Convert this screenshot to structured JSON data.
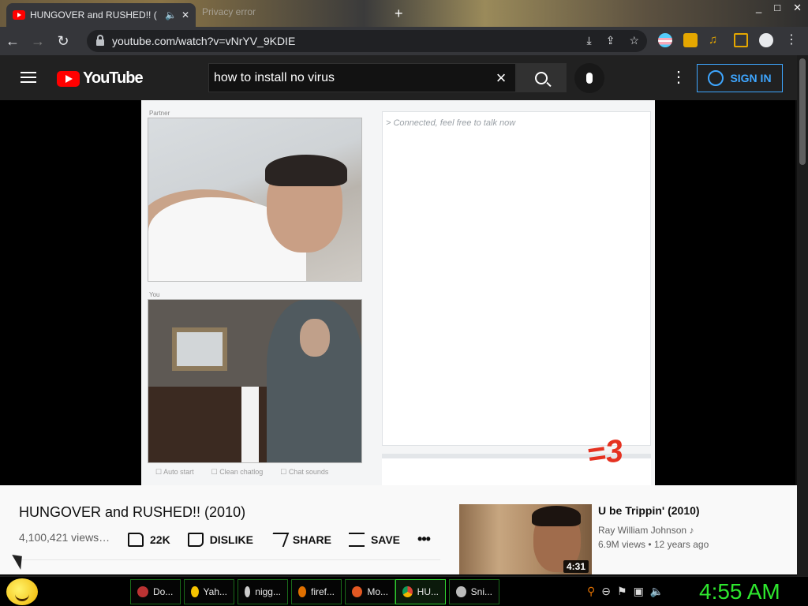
{
  "browser": {
    "tab_title": "HUNGOVER and RUSHED!! (",
    "tab2_title": "Privacy error",
    "new_tab": "+",
    "url": "youtube.com/watch?v=vNrYV_9KDIE",
    "controls": {
      "min": "_",
      "max": "□",
      "close": "✕"
    }
  },
  "youtube": {
    "logo_text": "YouTube",
    "search_value": "how to install no virus",
    "signin_label": "SIGN IN"
  },
  "player": {
    "partner_label": "Partner",
    "you_label": "You",
    "chat_message": "> Connected, feel free to talk now",
    "checkboxes": [
      "Auto start",
      "Clean chatlog",
      "Chat sounds"
    ],
    "overlay_text": "=3"
  },
  "video": {
    "title": "HUNGOVER and RUSHED!! (2010)",
    "views": "4,100,421 views…",
    "likes": "22K",
    "dislike_label": "DISLIKE",
    "share_label": "SHARE",
    "save_label": "SAVE",
    "more": "•••"
  },
  "recommendation": {
    "title": "U be Trippin' (2010)",
    "channel": "Ray William Johnson ♪",
    "meta": "6.9M views • 12 years ago",
    "duration": "4:31"
  },
  "taskbar": {
    "tasks": [
      "Do...",
      "Yah...",
      "nigg...",
      "firef...",
      "Mo...",
      "HU...",
      "Sni..."
    ],
    "clock": "4:55 AM"
  },
  "colors": {
    "yt_red": "#ff0000",
    "signin_blue": "#3ea6ff",
    "clock_green": "#2ee62e",
    "overlay_red": "#e53221"
  }
}
